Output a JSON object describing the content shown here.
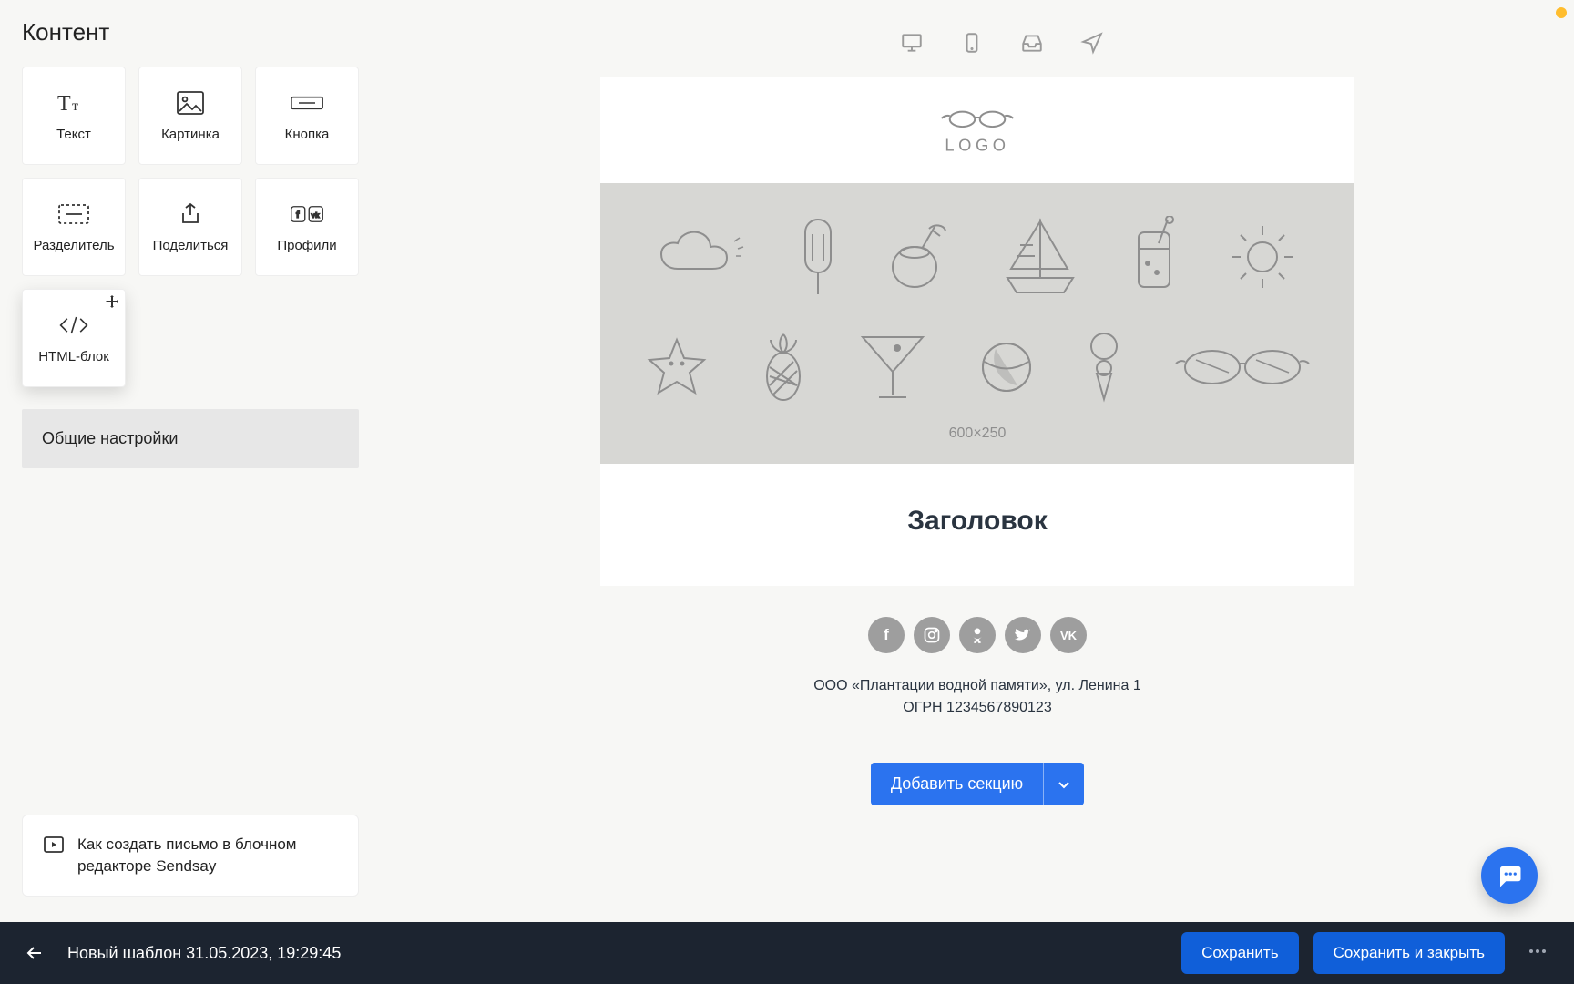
{
  "sidebar": {
    "title": "Контент",
    "blocks": [
      {
        "label": "Текст"
      },
      {
        "label": "Картинка"
      },
      {
        "label": "Кнопка"
      },
      {
        "label": "Разделитель"
      },
      {
        "label": "Поделиться"
      },
      {
        "label": "Профили"
      },
      {
        "label": "HTML-блок"
      }
    ],
    "settings_label": "Общие настройки",
    "help_text": "Как создать письмо в блочном редакторе Sendsay"
  },
  "email": {
    "logo_text": "LOGO",
    "hero_size": "600×250",
    "heading": "Заголовок",
    "footer_line1": "ООО «Плантации водной памяти», ул. Ленина 1",
    "footer_line2": "ОГРН 1234567890123",
    "add_section_label": "Добавить секцию",
    "social": [
      "facebook",
      "instagram",
      "odnoklassniki",
      "twitter",
      "vk"
    ]
  },
  "bottom": {
    "document_name": "Новый шаблон 31.05.2023, 19:29:45",
    "save_label": "Сохранить",
    "save_close_label": "Сохранить и закрыть"
  }
}
